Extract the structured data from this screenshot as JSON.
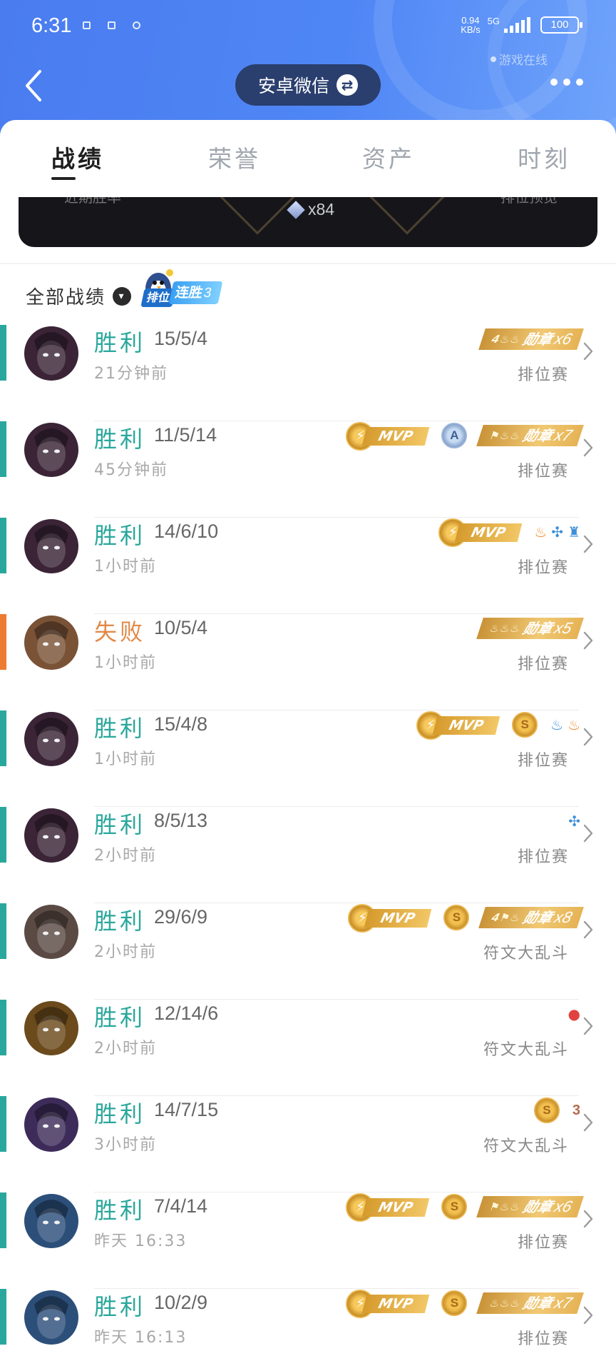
{
  "status_bar": {
    "time": "6:31",
    "net_speed": "0.94",
    "net_unit": "KB/s",
    "network": "5G",
    "battery": "100"
  },
  "header": {
    "account_name": "安卓微信",
    "game_status": "游戏在线"
  },
  "tabs": [
    {
      "label": "战绩",
      "active": true
    },
    {
      "label": "荣誉",
      "active": false
    },
    {
      "label": "资产",
      "active": false
    },
    {
      "label": "时刻",
      "active": false
    }
  ],
  "summary_card": {
    "left_label": "近期胜率",
    "right_label": "排位预览",
    "gem_count": "x84"
  },
  "filter": {
    "label": "全部战绩",
    "streak_tag_left": "排位",
    "streak_tag": "连胜",
    "streak_count": "3"
  },
  "matches": [
    {
      "result": "胜利",
      "kda": "15/5/4",
      "time": "21分钟前",
      "mode": "排位赛",
      "outcome": "win",
      "hero_color": "#3a2436",
      "badges": [
        {
          "type": "medal",
          "prefix": "4",
          "icons": "♨♨",
          "label": "勋章",
          "count": "x6"
        }
      ]
    },
    {
      "result": "胜利",
      "kda": "11/5/14",
      "time": "45分钟前",
      "mode": "排位赛",
      "outcome": "win",
      "hero_color": "#3a2436",
      "badges": [
        {
          "type": "mvp",
          "label": "MVP"
        },
        {
          "type": "coin_blue",
          "label": "A"
        },
        {
          "type": "medal",
          "prefix": "",
          "icons": "⚑♨♨",
          "label": "勋章",
          "count": "x7"
        }
      ]
    },
    {
      "result": "胜利",
      "kda": "14/6/10",
      "time": "1小时前",
      "mode": "排位赛",
      "outcome": "win",
      "hero_color": "#3a2436",
      "badges": [
        {
          "type": "mvp",
          "label": "MVP"
        },
        {
          "type": "small",
          "icons": [
            {
              "glyph": "♨",
              "tone": "orange"
            },
            {
              "glyph": "✣",
              "tone": "blue"
            },
            {
              "glyph": "♜",
              "tone": "blue"
            }
          ]
        }
      ]
    },
    {
      "result": "失败",
      "kda": "10/5/4",
      "time": "1小时前",
      "mode": "排位赛",
      "outcome": "loss",
      "hero_color": "#7a5236",
      "badges": [
        {
          "type": "medal",
          "prefix": "",
          "icons": "♨♨♨",
          "label": "勋章",
          "count": "x5"
        }
      ]
    },
    {
      "result": "胜利",
      "kda": "15/4/8",
      "time": "1小时前",
      "mode": "排位赛",
      "outcome": "win",
      "hero_color": "#3a2436",
      "badges": [
        {
          "type": "mvp",
          "label": "MVP"
        },
        {
          "type": "coin",
          "label": "S"
        },
        {
          "type": "small",
          "icons": [
            {
              "glyph": "♨",
              "tone": "blue"
            },
            {
              "glyph": "♨",
              "tone": "orange"
            }
          ]
        }
      ]
    },
    {
      "result": "胜利",
      "kda": "8/5/13",
      "time": "2小时前",
      "mode": "排位赛",
      "outcome": "win",
      "hero_color": "#3a2436",
      "badges": [
        {
          "type": "small",
          "icons": [
            {
              "glyph": "✣",
              "tone": "blue"
            }
          ]
        }
      ]
    },
    {
      "result": "胜利",
      "kda": "29/6/9",
      "time": "2小时前",
      "mode": "符文大乱斗",
      "outcome": "win",
      "hero_color": "#5b4a44",
      "badges": [
        {
          "type": "mvp",
          "label": "MVP"
        },
        {
          "type": "coin",
          "label": "S"
        },
        {
          "type": "medal",
          "prefix": "4",
          "icons": "⚑♨",
          "label": "勋章",
          "count": "x8"
        }
      ]
    },
    {
      "result": "胜利",
      "kda": "12/14/6",
      "time": "2小时前",
      "mode": "符文大乱斗",
      "outcome": "win",
      "hero_color": "#6b4a1c",
      "badges": [
        {
          "type": "small",
          "icons": [
            {
              "glyph": "●",
              "tone": "red"
            }
          ]
        }
      ]
    },
    {
      "result": "胜利",
      "kda": "14/7/15",
      "time": "3小时前",
      "mode": "符文大乱斗",
      "outcome": "win",
      "hero_color": "#3d2c5a",
      "badges": [
        {
          "type": "coin",
          "label": "S"
        },
        {
          "type": "small",
          "icons": [
            {
              "glyph": "3",
              "tone": "brown"
            }
          ]
        }
      ]
    },
    {
      "result": "胜利",
      "kda": "7/4/14",
      "time": "昨天 16:33",
      "mode": "排位赛",
      "outcome": "win",
      "hero_color": "#2c4f7a",
      "badges": [
        {
          "type": "mvp",
          "label": "MVP"
        },
        {
          "type": "coin",
          "label": "S"
        },
        {
          "type": "medal",
          "prefix": "",
          "icons": "⚑♨♨",
          "label": "勋章",
          "count": "x6"
        }
      ]
    },
    {
      "result": "胜利",
      "kda": "10/2/9",
      "time": "昨天 16:13",
      "mode": "排位赛",
      "outcome": "win",
      "hero_color": "#2c4f7a",
      "badges": [
        {
          "type": "mvp",
          "label": "MVP"
        },
        {
          "type": "coin",
          "label": "S"
        },
        {
          "type": "medal",
          "prefix": "",
          "icons": "♨♨♨",
          "label": "勋章",
          "count": "x7"
        }
      ]
    }
  ]
}
